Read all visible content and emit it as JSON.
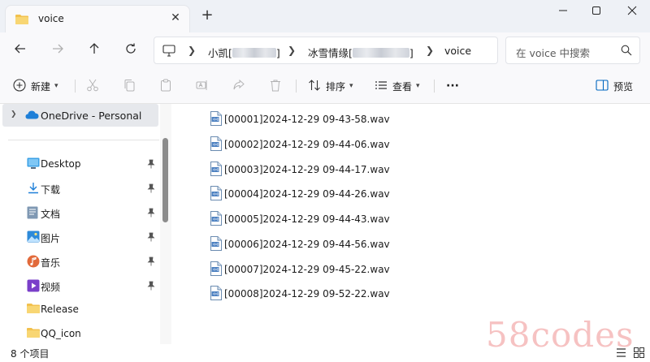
{
  "window": {
    "tab_title": "voice",
    "new_tab": "+",
    "close_tab": "✕"
  },
  "nav": {
    "breadcrumbs": [
      "小凯[",
      "]",
      "冰雪情缘[",
      "]",
      "voice"
    ],
    "search_placeholder": "在 voice 中搜索"
  },
  "toolbar": {
    "new_label": "新建",
    "sort_label": "排序",
    "view_label": "查看",
    "more_label": "···",
    "preview_label": "预览"
  },
  "sidebar": {
    "onedrive": "OneDrive - Personal",
    "items": [
      {
        "label": "Desktop",
        "icon": "desktop-icon"
      },
      {
        "label": "下载",
        "icon": "download-icon"
      },
      {
        "label": "文档",
        "icon": "document-icon"
      },
      {
        "label": "图片",
        "icon": "pictures-icon"
      },
      {
        "label": "音乐",
        "icon": "music-icon"
      },
      {
        "label": "视频",
        "icon": "video-icon"
      },
      {
        "label": "Release",
        "icon": "folder-icon"
      },
      {
        "label": "QQ_icon",
        "icon": "folder-icon"
      }
    ]
  },
  "files": [
    "[00001]2024-12-29 09-43-58.wav",
    "[00002]2024-12-29 09-44-06.wav",
    "[00003]2024-12-29 09-44-17.wav",
    "[00004]2024-12-29 09-44-26.wav",
    "[00005]2024-12-29 09-44-43.wav",
    "[00006]2024-12-29 09-44-56.wav",
    "[00007]2024-12-29 09-45-22.wav",
    "[00008]2024-12-29 09-52-22.wav"
  ],
  "status": {
    "count": "8 个项目"
  },
  "watermark": "58codes",
  "colors": {
    "titlebar": "#eef1f6",
    "selection": "#e6e8ec",
    "accent": "#0067c0",
    "watermark": "#eb7878"
  }
}
